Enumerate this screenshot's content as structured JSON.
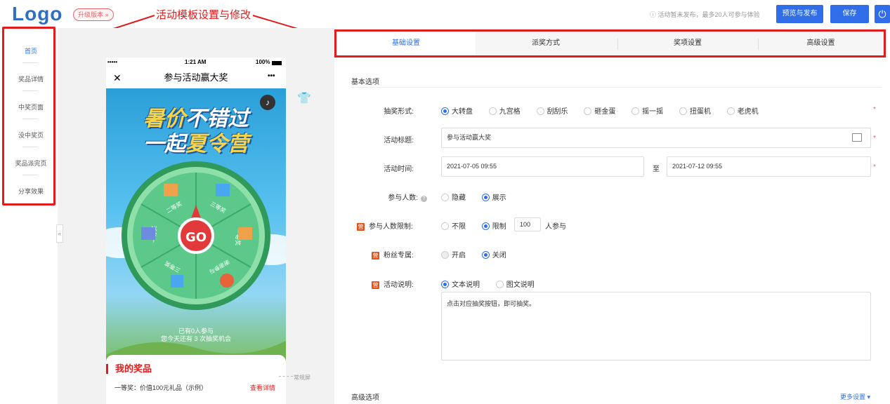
{
  "topbar": {
    "logo": "Logo",
    "upgrade": "升级版本 »",
    "annotation": "活动模板设置与修改",
    "notice": "ⓘ 活动暂未发布，最多20人可参与体验",
    "preview_button": "预览与发布",
    "save_button": "保存",
    "power_icon": "⏻"
  },
  "leftnav": {
    "items": [
      {
        "label": "首页",
        "active": true
      },
      {
        "label": "奖品详情"
      },
      {
        "label": "中奖页面"
      },
      {
        "label": "没中奖页"
      },
      {
        "label": "奖品派完页"
      },
      {
        "label": "分享效果"
      }
    ],
    "collapse_icon": "«"
  },
  "phone": {
    "status_signal": "•••••",
    "status_time": "1:21 AM",
    "status_battery": "100%",
    "close_icon": "✕",
    "title": "参与活动赢大奖",
    "more_icon": "•••",
    "music_icon": "♪",
    "headline_1a": "暑价",
    "headline_1b": "不错过",
    "headline_2a": "一起",
    "headline_2b": "夏令营",
    "wheel": {
      "center": "GO",
      "prizes": [
        "二等奖",
        "三等奖",
        "一等奖",
        "谢谢参与",
        "三等奖",
        "一等奖"
      ]
    },
    "participants": "已有0人参与",
    "chances": "您今天还有 3 次抽奖机会",
    "my_prizes_title": "我的奖品",
    "prize_line": "一等奖：价值100元礼品（示例）",
    "prize_link": "查看详情"
  },
  "canvas": {
    "shirt_icon": "👕",
    "normal_screen": "常规屏"
  },
  "tabs": [
    "基础设置",
    "派奖方式",
    "奖项设置",
    "高级设置"
  ],
  "form": {
    "basic_title": "基本选项",
    "mode_label": "抽奖形式:",
    "mode_options": [
      {
        "label": "大转盘",
        "checked": true
      },
      {
        "label": "九宫格"
      },
      {
        "label": "刮刮乐"
      },
      {
        "label": "砸金蛋"
      },
      {
        "label": "摇一摇"
      },
      {
        "label": "扭蛋机"
      },
      {
        "label": "老虎机"
      }
    ],
    "title_label": "活动标题:",
    "title_value": "参与活动赢大奖",
    "time_label": "活动时间:",
    "time_start": "2021-07-05 09:55",
    "time_to": "至",
    "time_end": "2021-07-12 09:55",
    "count_label": "参与人数:",
    "count_options": [
      {
        "label": "隐藏"
      },
      {
        "label": "展示",
        "checked": true
      }
    ],
    "limit_label": "参与人数限制:",
    "limit_options": [
      {
        "label": "不限"
      },
      {
        "label": "限制",
        "checked": true
      }
    ],
    "limit_value": "100",
    "limit_suffix": "人参与",
    "fans_label": "粉丝专属:",
    "fans_options": [
      {
        "label": "开启"
      },
      {
        "label": "关闭",
        "checked": true
      }
    ],
    "desc_label": "活动说明:",
    "desc_options": [
      {
        "label": "文本说明",
        "checked": true
      },
      {
        "label": "图文说明"
      }
    ],
    "desc_text": "点击对应抽奖按钮，即可抽奖。",
    "badge": "营",
    "help": "?",
    "required": "*",
    "advanced_title": "高级选项",
    "more_settings": "更多设置 ▾"
  },
  "colors": {
    "accent": "#2f6ee8",
    "annotation": "#e21c1c",
    "brand_logo": "#2f6fc2"
  }
}
